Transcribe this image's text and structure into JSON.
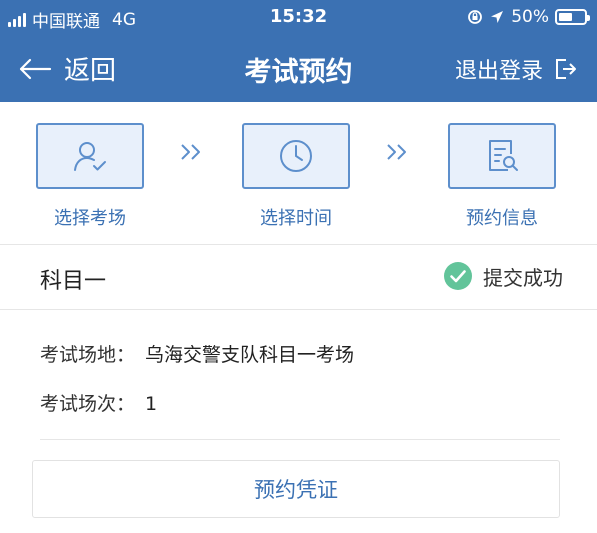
{
  "status_bar": {
    "carrier": "中国联通",
    "network": "4G",
    "time": "15:32",
    "battery": "50%",
    "battery_level": 0.5
  },
  "nav": {
    "back_label": "返回",
    "title": "考试预约",
    "logout_label": "退出登录"
  },
  "steps": [
    {
      "label": "选择考场",
      "icon": "user-check-icon"
    },
    {
      "label": "选择时间",
      "icon": "clock-icon"
    },
    {
      "label": "预约信息",
      "icon": "document-search-icon"
    }
  ],
  "result": {
    "subject": "科目一",
    "status": "提交成功"
  },
  "details": {
    "venue_label": "考试场地：",
    "venue_value": "乌海交警支队科目一考场",
    "session_label": "考试场次：",
    "session_value": "1"
  },
  "certificate_button": "预约凭证",
  "colors": {
    "primary": "#3b71b3",
    "success": "#62c49a",
    "step_bg": "#e8f0fb"
  }
}
